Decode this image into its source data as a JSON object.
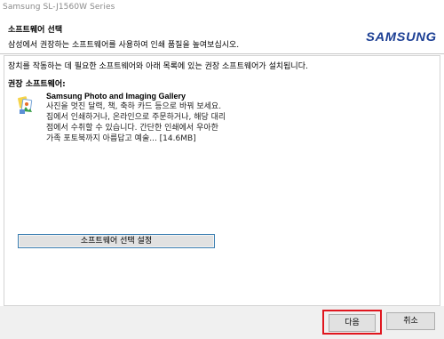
{
  "window": {
    "title": "Samsung SL-J1560W Series"
  },
  "header": {
    "title": "소프트웨어 선택",
    "subtitle": "삼성에서 권장하는 소프트웨어를 사용하여 인쇄 품질을 높여보십시오.",
    "logo_text": "SAMSUNG",
    "logo_color": "#1c3f94"
  },
  "content": {
    "description": "장치를 작동하는 데 필요한 소프트웨어와 아래 목록에 있는 권장 소프트웨어가 설치됩니다.",
    "recommended_label": "권장 소프트웨어:",
    "software": [
      {
        "name": "Samsung Photo and Imaging Gallery",
        "icon": "photo-gallery-icon",
        "desc_lines": [
          "사진을 멋진 달력, 책, 축하 카드 등으로 바꿔 보세요.",
          "집에서 인쇄하거나, 온라인으로 주문하거나, 해당 대리",
          "점에서 수취할 수 있습니다. 간단한 인쇄에서 우아한",
          "가족 포토북까지 아름답고 예술... [14.6MB]"
        ]
      }
    ],
    "select_button": "소프트웨어 선택 설정"
  },
  "footer": {
    "next_label": "다음",
    "cancel_label": "취소",
    "highlight_color": "#e0161e"
  }
}
